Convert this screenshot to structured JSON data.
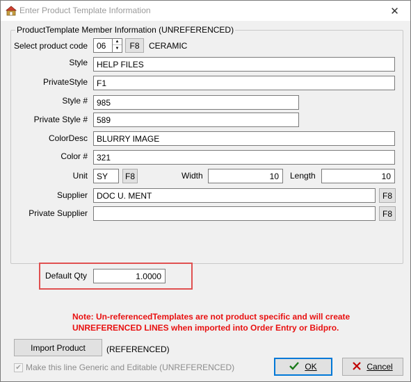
{
  "window": {
    "title": "Enter Product Template Information"
  },
  "group": {
    "legend": "ProductTemplate Member Information (UNREFERENCED)"
  },
  "product_code": {
    "label": "Select product code",
    "value": "06",
    "f8": "F8",
    "desc": "CERAMIC"
  },
  "style": {
    "label": "Style",
    "value": "HELP FILES"
  },
  "private_style": {
    "label": "PrivateStyle",
    "value": "F1"
  },
  "style_num": {
    "label": "Style #",
    "value": "985"
  },
  "private_style_num": {
    "label": "Private Style #",
    "value": "589"
  },
  "color_desc": {
    "label": "ColorDesc",
    "value": "BLURRY IMAGE"
  },
  "color_num": {
    "label": "Color #",
    "value": "321"
  },
  "unit": {
    "label": "Unit",
    "value": "SY",
    "f8": "F8"
  },
  "width": {
    "label": "Width",
    "value": "10"
  },
  "length": {
    "label": "Length",
    "value": "10"
  },
  "supplier": {
    "label": "Supplier",
    "value": "DOC U. MENT",
    "f8": "F8"
  },
  "private_supplier": {
    "label": "Private Supplier",
    "value": "",
    "f8": "F8"
  },
  "default_qty": {
    "label": "Default Qty",
    "value": "1.0000"
  },
  "note": {
    "line1": "Note: Un-referencedTemplates are not product specific and will create",
    "line2": "UNREFERENCED LINES when imported into Order Entry or Bidpro."
  },
  "import": {
    "button": "Import Product",
    "status": "(REFERENCED)"
  },
  "generic": {
    "label": "Make this line Generic and Editable (UNREFERENCED)",
    "checked": true
  },
  "buttons": {
    "ok": "OK",
    "cancel": "Cancel"
  },
  "colors": {
    "note": "#e81010",
    "highlight": "#e05050",
    "ok_check": "#1a7a1a",
    "cancel_x": "#c00000"
  }
}
